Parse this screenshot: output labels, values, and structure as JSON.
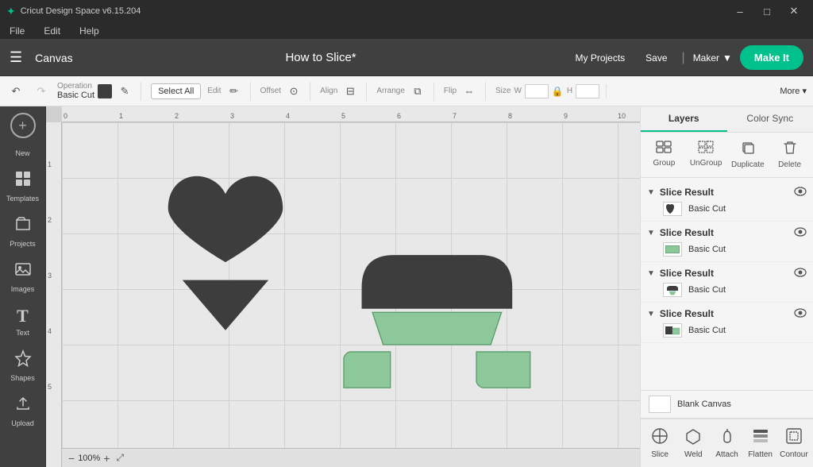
{
  "titlebar": {
    "title": "Cricut Design Space  v6.15.204",
    "controls": [
      "minimize",
      "maximize",
      "close"
    ]
  },
  "menubar": {
    "items": [
      "File",
      "Edit",
      "Help"
    ]
  },
  "header": {
    "canvas_label": "Canvas",
    "project_title": "How to Slice*",
    "my_projects_label": "My Projects",
    "save_label": "Save",
    "maker_label": "Maker",
    "make_it_label": "Make It"
  },
  "subtoolbar": {
    "operation_label": "Operation",
    "operation_value": "Basic Cut",
    "select_all_label": "Select All",
    "edit_label": "Edit",
    "offset_label": "Offset",
    "align_label": "Align",
    "arrange_label": "Arrange",
    "flip_label": "Flip",
    "size_label": "Size",
    "w_label": "W",
    "h_label": "H",
    "more_label": "More ▾"
  },
  "left_sidebar": {
    "new_label": "New",
    "items": [
      {
        "id": "templates",
        "label": "Templates",
        "icon": "⬜"
      },
      {
        "id": "projects",
        "label": "Projects",
        "icon": "📁"
      },
      {
        "id": "images",
        "label": "Images",
        "icon": "🖼"
      },
      {
        "id": "text",
        "label": "Text",
        "icon": "T"
      },
      {
        "id": "shapes",
        "label": "Shapes",
        "icon": "⭐"
      },
      {
        "id": "upload",
        "label": "Upload",
        "icon": "⬆"
      }
    ]
  },
  "canvas": {
    "zoom_level": "100%",
    "ruler_marks": [
      "0",
      "1",
      "2",
      "3",
      "4",
      "5",
      "6",
      "7",
      "8",
      "9",
      "10"
    ]
  },
  "right_panel": {
    "tabs": [
      {
        "id": "layers",
        "label": "Layers",
        "active": true
      },
      {
        "id": "color_sync",
        "label": "Color Sync",
        "active": false
      }
    ],
    "actions": [
      {
        "id": "group",
        "label": "Group",
        "icon": "▣",
        "disabled": false
      },
      {
        "id": "ungroup",
        "label": "UnGroup",
        "icon": "⊞",
        "disabled": false
      },
      {
        "id": "duplicate",
        "label": "Duplicate",
        "icon": "❑",
        "disabled": false
      },
      {
        "id": "delete",
        "label": "Delete",
        "icon": "🗑",
        "disabled": false
      }
    ],
    "layers": [
      {
        "id": "layer1",
        "title": "Slice Result",
        "cut_label": "Basic Cut",
        "thumb_type": "dots"
      },
      {
        "id": "layer2",
        "title": "Slice Result",
        "cut_label": "Basic Cut",
        "thumb_type": "green"
      },
      {
        "id": "layer3",
        "title": "Slice Result",
        "cut_label": "Basic Cut",
        "thumb_type": "heart"
      },
      {
        "id": "layer4",
        "title": "Slice Result",
        "cut_label": "Basic Cut",
        "thumb_type": "dark_green"
      }
    ],
    "blank_canvas_label": "Blank Canvas",
    "bottom_actions": [
      {
        "id": "slice",
        "label": "Slice",
        "icon": "◎"
      },
      {
        "id": "weld",
        "label": "Weld",
        "icon": "⬡"
      },
      {
        "id": "attach",
        "label": "Attach",
        "icon": "📎"
      },
      {
        "id": "flatten",
        "label": "Flatten",
        "icon": "⬛"
      },
      {
        "id": "contour",
        "label": "Contour",
        "icon": "◻"
      }
    ]
  }
}
